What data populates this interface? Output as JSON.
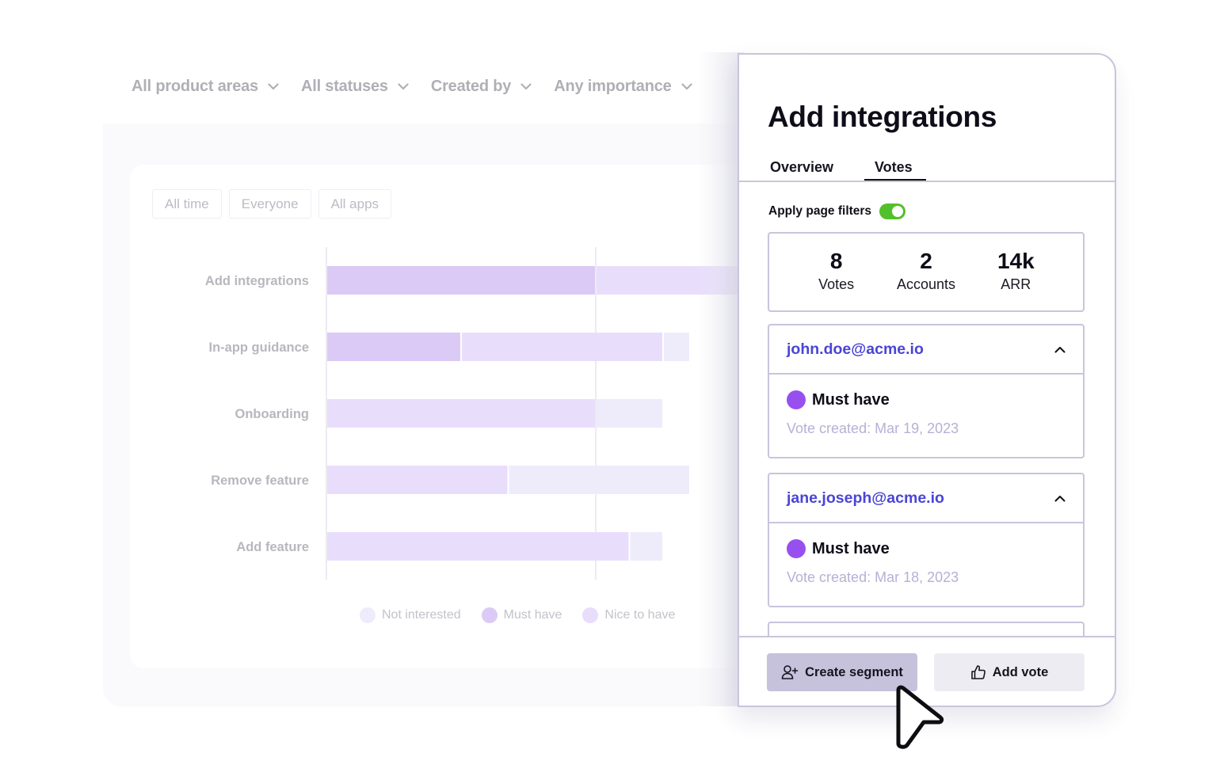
{
  "filters": {
    "dropdowns": [
      {
        "label": "All product areas",
        "icon": "chevron-down-icon"
      },
      {
        "label": "All statuses",
        "icon": "chevron-down-icon"
      },
      {
        "label": "Created by",
        "icon": "chevron-down-icon"
      },
      {
        "label": "Any importance",
        "icon": "chevron-down-icon"
      }
    ],
    "pills": [
      "All time",
      "Everyone",
      "All apps"
    ]
  },
  "colors": {
    "must_have": "#dccaf6",
    "nice_to_have": "#e8defc",
    "not_interested": "#eeecfb",
    "must_have_dot": "#9750ef",
    "email_link": "#4a45d6",
    "toggle_on": "#52c02a"
  },
  "chart_data": {
    "type": "bar",
    "orientation": "horizontal",
    "stacked": true,
    "title": "",
    "xlabel": "",
    "ylabel": "",
    "categories": [
      "Add integrations",
      "In-app guidance",
      "Onboarding",
      "Remove feature",
      "Add feature"
    ],
    "series": [
      {
        "name": "Must have",
        "values": [
          4,
          2,
          0,
          0,
          0
        ]
      },
      {
        "name": "Nice to have",
        "values": [
          3,
          3,
          4,
          2.7,
          4.5
        ]
      },
      {
        "name": "Not interested",
        "values": [
          0,
          0.4,
          1,
          2.7,
          0.5
        ]
      }
    ],
    "xlim": [
      0,
      8
    ],
    "gridlines_at": [
      0,
      4
    ],
    "legend": {
      "position": "bottom",
      "entries": [
        "Not interested",
        "Must have",
        "Nice to have"
      ]
    }
  },
  "panel": {
    "title": "Add integrations",
    "tabs": [
      {
        "label": "Overview",
        "active": false
      },
      {
        "label": "Votes",
        "active": true
      }
    ],
    "apply_filters": {
      "label": "Apply page filters",
      "enabled": true
    },
    "stats": [
      {
        "value": "8",
        "label": "Votes"
      },
      {
        "value": "2",
        "label": "Accounts"
      },
      {
        "value": "14k",
        "label": "ARR"
      }
    ],
    "votes": [
      {
        "email": "john.doe@acme.io",
        "importance": "Must have",
        "created": "Vote created: Mar 19, 2023",
        "expanded": true
      },
      {
        "email": "jane.joseph@acme.io",
        "importance": "Must have",
        "created": "Vote created: Mar 18, 2023",
        "expanded": true
      }
    ],
    "buttons": {
      "create_segment": "Create segment",
      "add_vote": "Add vote"
    }
  }
}
